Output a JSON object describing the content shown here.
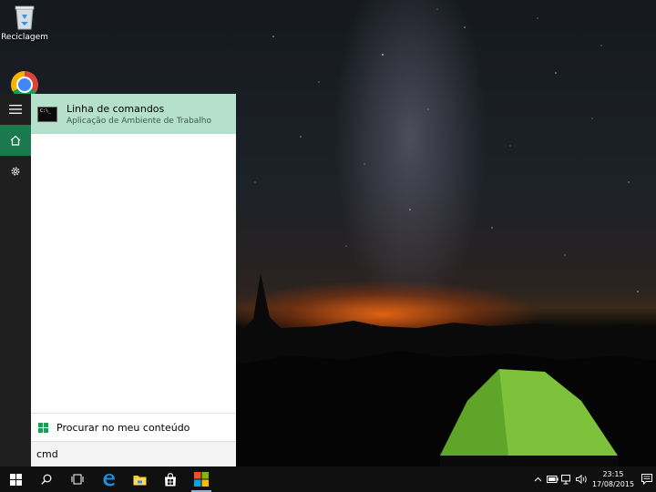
{
  "desktop": {
    "icons": [
      {
        "label": "Reciclagem",
        "icon": "recycle-bin-icon"
      },
      {
        "label": "",
        "icon": "chrome-icon"
      }
    ]
  },
  "start_rail": {
    "items": [
      {
        "icon": "hamburger-menu-icon"
      },
      {
        "icon": "home-icon",
        "active": true
      },
      {
        "icon": "settings-gear-icon"
      }
    ]
  },
  "search_results": {
    "best_match": {
      "title": "Linha de comandos",
      "subtitle": "Aplicação de Ambiente de Trabalho",
      "icon": "command-prompt-icon"
    },
    "my_stuff_label": "Procurar no meu conteúdo"
  },
  "search_box": {
    "value": "cmd"
  },
  "taskbar": {
    "pinned": [
      {
        "icon": "windows-start-icon"
      },
      {
        "icon": "search-icon"
      },
      {
        "icon": "task-view-icon"
      },
      {
        "icon": "edge-icon"
      },
      {
        "icon": "file-explorer-icon"
      },
      {
        "icon": "store-icon"
      },
      {
        "icon": "office-icon"
      }
    ],
    "tray": {
      "icons": [
        "chevron-up-icon",
        "battery-icon",
        "network-icon",
        "volume-icon"
      ],
      "time": "23:15",
      "date": "17/08/2015"
    }
  },
  "colors": {
    "accent_green": "#1b7a4d",
    "result_highlight": "#b5e0cc",
    "taskbar": "#101010",
    "rail": "#1f1f1f"
  }
}
